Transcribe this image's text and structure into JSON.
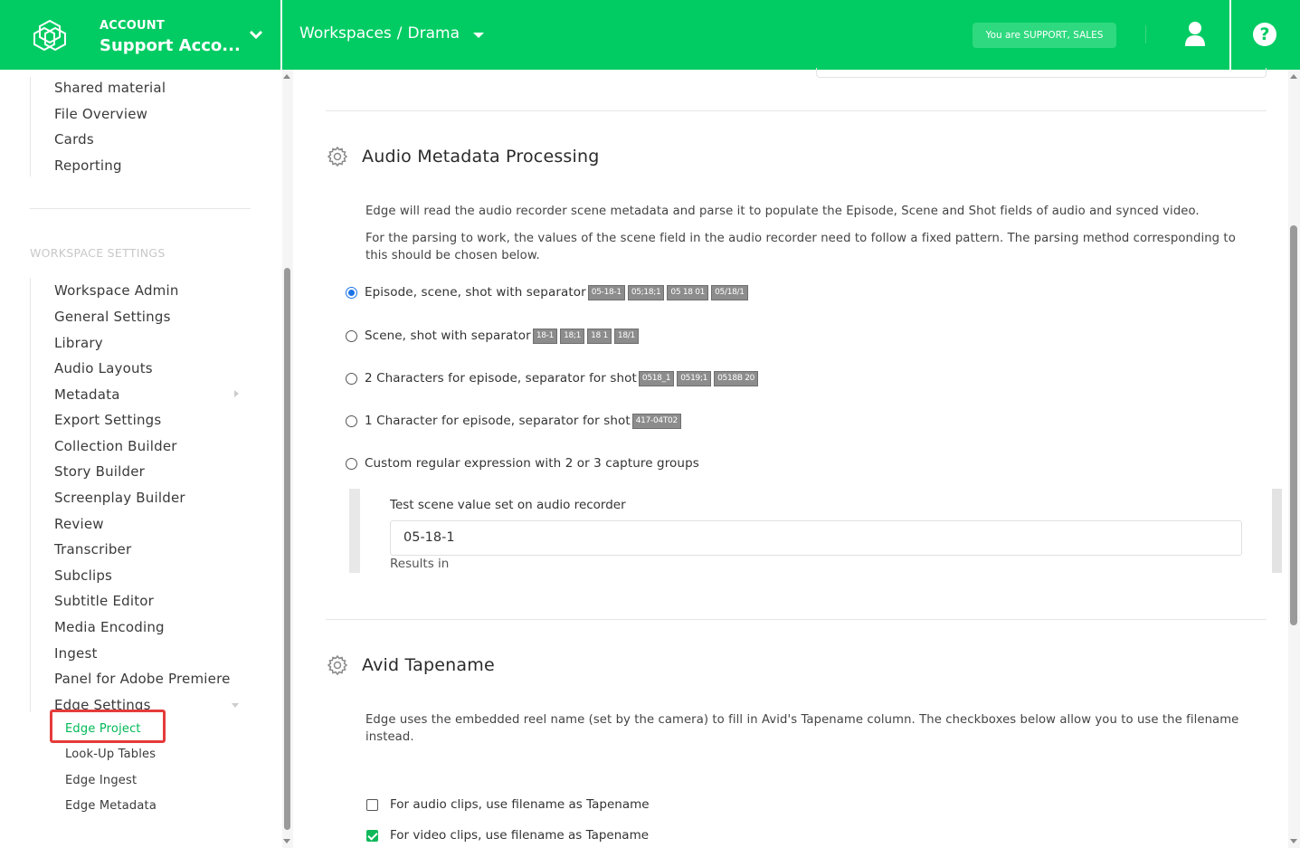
{
  "header": {
    "account_label": "ACCOUNT",
    "account_name": "Support Acco...",
    "breadcrumb": [
      "Workspaces",
      "Drama"
    ],
    "role_badge": "You are SUPPORT, SALES",
    "help_label": "?"
  },
  "sidebar": {
    "top_items": [
      "Shared material",
      "File Overview",
      "Cards",
      "Reporting"
    ],
    "section_label": "WORKSPACE SETTINGS",
    "items": [
      "Workspace Admin",
      "General Settings",
      "Library",
      "Audio Layouts",
      "Metadata",
      "Export Settings",
      "Collection Builder",
      "Story Builder",
      "Screenplay Builder",
      "Review",
      "Transcriber",
      "Subclips",
      "Subtitle Editor",
      "Media Encoding",
      "Ingest",
      "Panel for Adobe Premiere",
      "Edge Settings"
    ],
    "sub_items": [
      "Edge Project",
      "Look-Up Tables",
      "Edge Ingest",
      "Edge Metadata"
    ],
    "active_sub": "Edge Project"
  },
  "audio_meta": {
    "title": "Audio Metadata Processing",
    "desc1": "Edge will read the audio recorder scene metadata and parse it to populate the Episode, Scene and Shot fields of audio and synced video.",
    "desc2": "For the parsing to work, the values of the scene field in the audio recorder need to follow a fixed pattern. The parsing method corresponding to this should be chosen below.",
    "options": [
      {
        "label": "Episode, scene, shot with separator",
        "chips": [
          "05-18-1",
          "05;18;1",
          "05 18 01",
          "05/18/1"
        ],
        "checked": true
      },
      {
        "label": "Scene, shot with separator",
        "chips": [
          "18-1",
          "18;1",
          "18 1",
          "18/1"
        ],
        "checked": false
      },
      {
        "label": "2 Characters for episode, separator for shot",
        "chips": [
          "0518_1",
          "0519;1",
          "0518B 20"
        ],
        "checked": false
      },
      {
        "label": "1 Character for episode, separator for shot",
        "chips": [
          "417-04T02"
        ],
        "checked": false
      },
      {
        "label": "Custom regular expression with 2 or 3 capture groups",
        "chips": [],
        "checked": false
      }
    ],
    "test_label": "Test scene value set on audio recorder",
    "test_value": "05-18-1",
    "results_label": "Results in"
  },
  "avid": {
    "title": "Avid Tapename",
    "desc": "Edge uses the embedded reel name (set by the camera) to fill in Avid's Tapename column. The checkboxes below allow you to use the filename instead.",
    "audio_cb": "For audio clips, use filename as Tapename",
    "audio_checked": false,
    "video_cb": "For video clips, use filename as Tapename",
    "video_checked": true
  },
  "colors": {
    "brand": "#00cc63",
    "active_nav": "#00b956",
    "highlight": "#e53b3b",
    "radio": "#1a73e8"
  }
}
